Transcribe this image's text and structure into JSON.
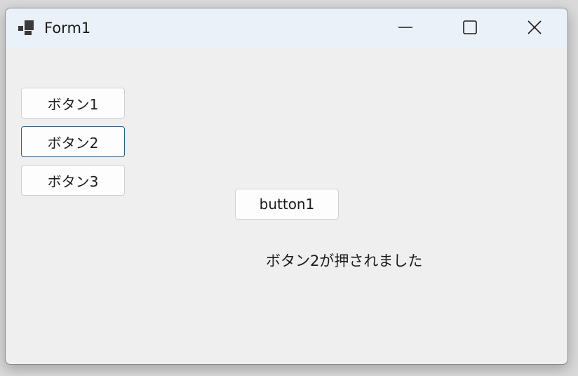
{
  "window": {
    "title": "Form1",
    "controls": {
      "minimize": "minimize-icon",
      "maximize": "maximize-icon",
      "close": "close-icon"
    },
    "titlebar_color": "#ebf1f8",
    "client_color": "#efefef",
    "focus_color": "#1f5fa3"
  },
  "buttons": {
    "button_1": "ボタン1",
    "button_2": "ボタン2",
    "button_3": "ボタン3",
    "button1_en": "button1"
  },
  "status": {
    "message": "ボタン2が押されました"
  }
}
